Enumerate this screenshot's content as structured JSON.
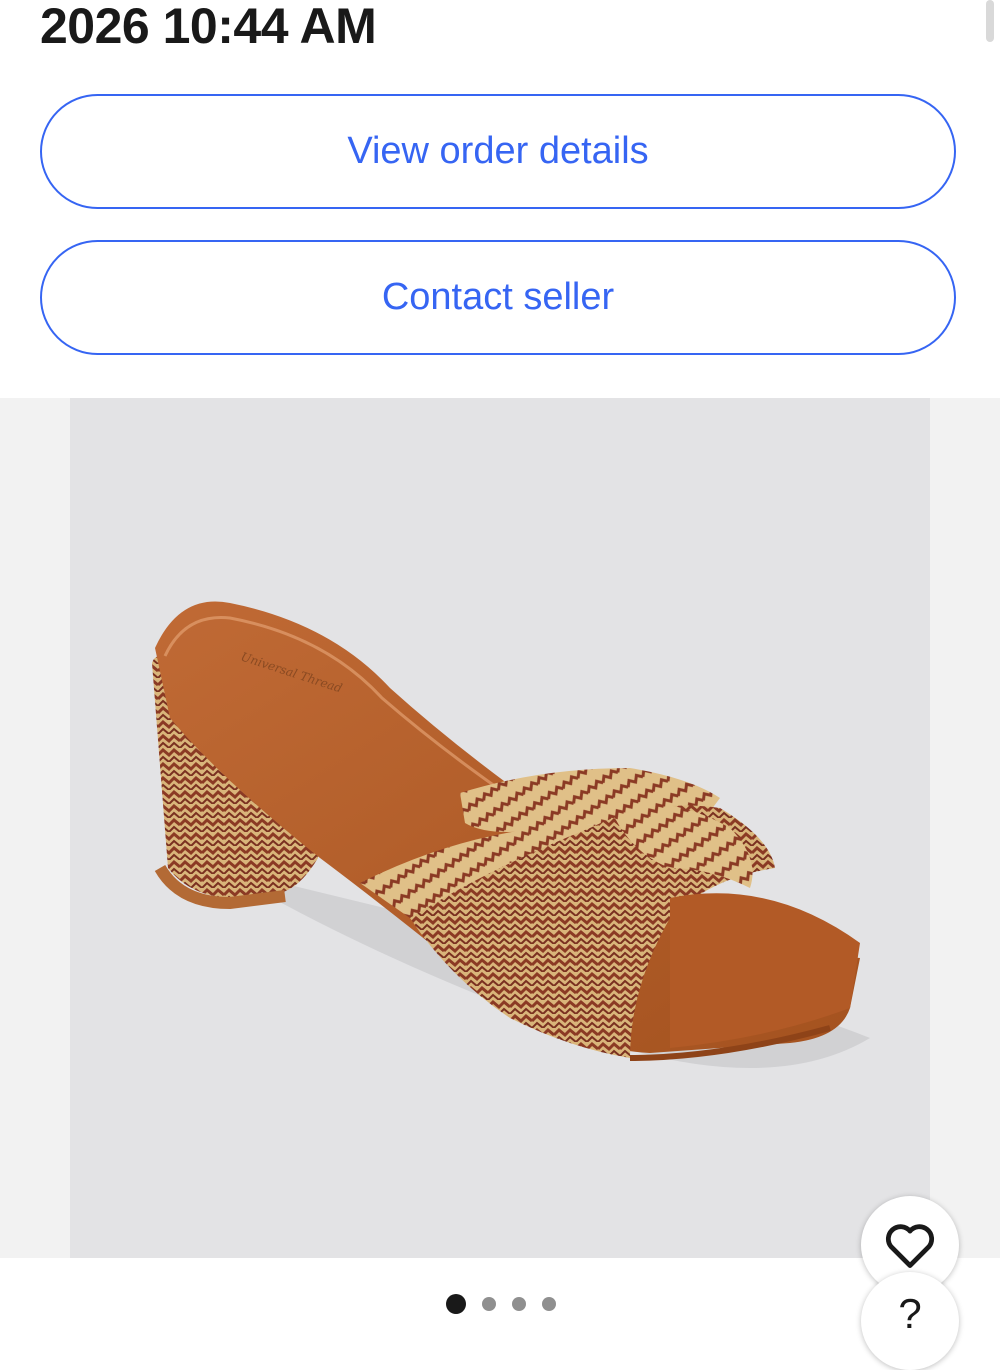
{
  "order": {
    "datetime": "2026 10:44 AM"
  },
  "actions": {
    "view_order_label": "View order details",
    "contact_seller_label": "Contact seller"
  },
  "gallery": {
    "image_description_icon": "product-photo-sandal",
    "slide_count": 4,
    "active_slide": 1
  },
  "fab": {
    "favorite_icon": "heart-icon",
    "help_label": "?"
  },
  "colors": {
    "accent": "#3665f3",
    "text": "#191919"
  }
}
